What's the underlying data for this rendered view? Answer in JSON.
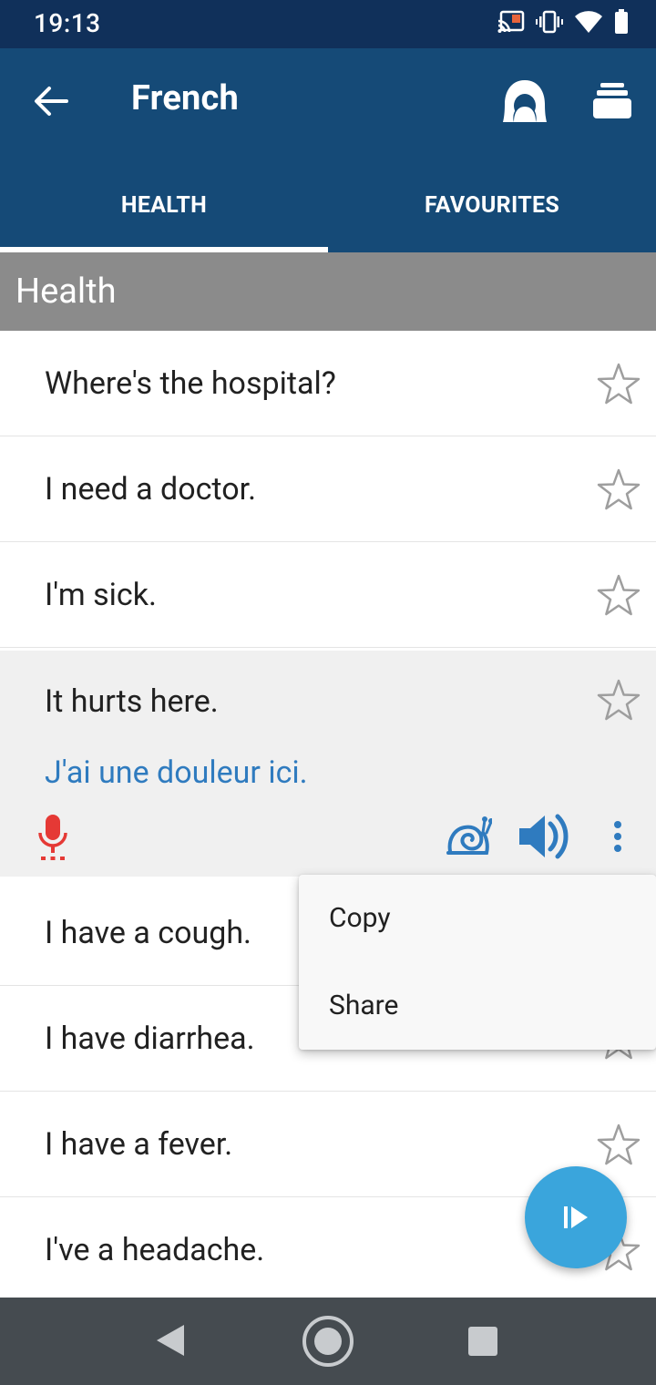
{
  "status_bar": {
    "time": "19:13",
    "icons": [
      "cast-icon",
      "vibrate-icon",
      "wifi-icon",
      "battery-icon"
    ]
  },
  "app_bar": {
    "title": "French",
    "back_icon": "arrow-back-icon",
    "actions": [
      "profile-icon",
      "stack-icon"
    ]
  },
  "tabs": [
    {
      "label": "HEALTH",
      "selected": true
    },
    {
      "label": "FAVOURITES",
      "selected": false
    }
  ],
  "section": {
    "title": "Health"
  },
  "phrases": [
    {
      "text": "Where's the hospital?"
    },
    {
      "text": "I need a doctor."
    },
    {
      "text": "I'm sick."
    },
    {
      "text": "It hurts here.",
      "translation": "J'ai une douleur ici.",
      "expanded": true
    },
    {
      "text": "I have a cough."
    },
    {
      "text": "I have diarrhea."
    },
    {
      "text": "I have a fever."
    },
    {
      "text": "I've a headache."
    }
  ],
  "context_menu": {
    "items": [
      {
        "label": "Copy"
      },
      {
        "label": "Share"
      }
    ]
  },
  "colors": {
    "status_bar": "#10305a",
    "app_bar": "#154a77",
    "section_header": "#8b8b8b",
    "translation": "#2f7bbf",
    "mic": "#e53935",
    "fab": "#3aa5dc",
    "nav_bar": "#454b50"
  }
}
